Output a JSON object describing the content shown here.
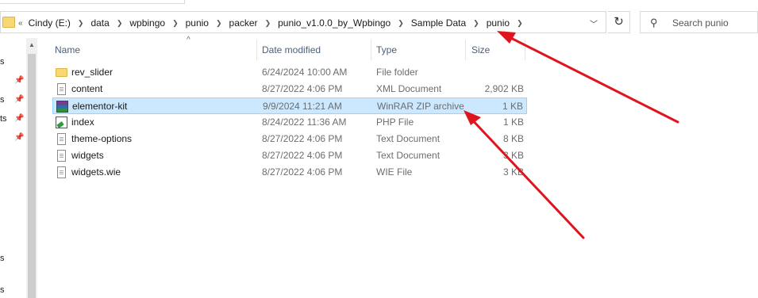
{
  "breadcrumb": [
    "Cindy (E:)",
    "data",
    "wpbingo",
    "punio",
    "packer",
    "punio_v1.0.0_by_Wpbingo",
    "Sample Data",
    "punio"
  ],
  "overflow_chevron": "«",
  "search_placeholder": "Search punio",
  "columns": {
    "name": "Name",
    "date": "Date modified",
    "type": "Type",
    "size": "Size"
  },
  "files": [
    {
      "name": "rev_slider",
      "date": "6/24/2024 10:00 AM",
      "type": "File folder",
      "size": "",
      "icon": "folder-icon"
    },
    {
      "name": "content",
      "date": "8/27/2022 4:06 PM",
      "type": "XML Document",
      "size": "2,902 KB",
      "icon": "document-icon"
    },
    {
      "name": "elementor-kit",
      "date": "9/9/2024 11:21 AM",
      "type": "WinRAR ZIP archive",
      "size": "1 KB",
      "icon": "winrar-zip-icon",
      "selected": true
    },
    {
      "name": "index",
      "date": "8/24/2022 11:36 AM",
      "type": "PHP File",
      "size": "1 KB",
      "icon": "php-file-icon"
    },
    {
      "name": "theme-options",
      "date": "8/27/2022 4:06 PM",
      "type": "Text Document",
      "size": "8 KB",
      "icon": "document-icon"
    },
    {
      "name": "widgets",
      "date": "8/27/2022 4:06 PM",
      "type": "Text Document",
      "size": "3 KB",
      "icon": "document-icon"
    },
    {
      "name": "widgets.wie",
      "date": "8/27/2022 4:06 PM",
      "type": "WIE File",
      "size": "3 KB",
      "icon": "document-icon"
    }
  ],
  "nav_fragments": [
    "s",
    "s",
    "ts",
    "s",
    "s"
  ],
  "annotation_color": "#e0141e"
}
